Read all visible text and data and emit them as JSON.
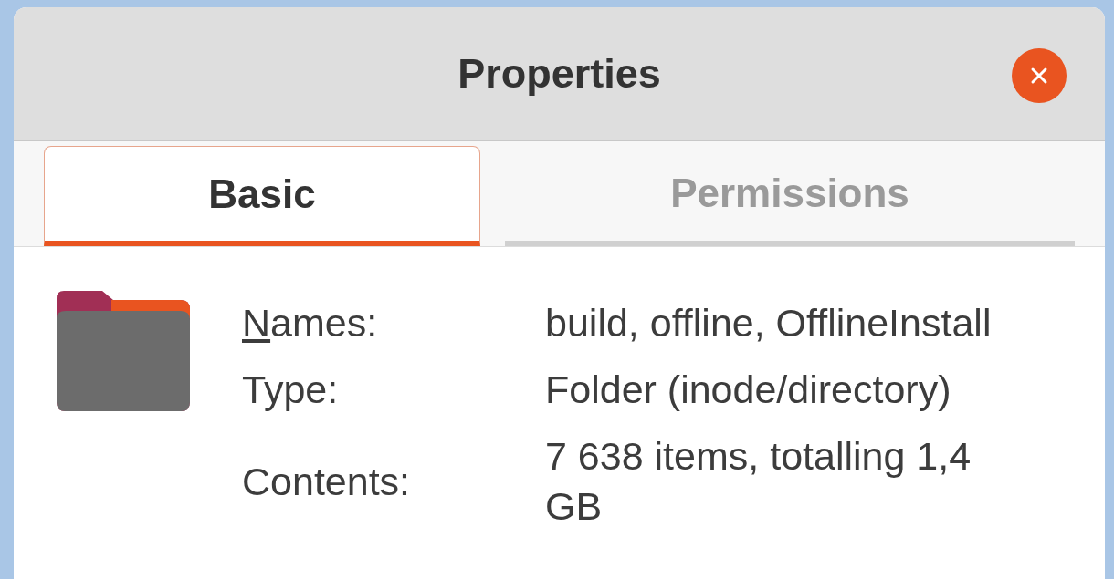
{
  "window": {
    "title": "Properties"
  },
  "tabs": [
    {
      "label": "Basic",
      "selected": true
    },
    {
      "label": "Permissions",
      "selected": false
    }
  ],
  "properties": [
    {
      "label": "Names:",
      "mnemonic": true,
      "value": "build, offline, OfflineInstall"
    },
    {
      "label": "Type:",
      "mnemonic": false,
      "value": "Folder (inode/directory)"
    },
    {
      "label": "Contents:",
      "mnemonic": false,
      "value": "7 638 items, totalling 1,4 GB"
    }
  ]
}
